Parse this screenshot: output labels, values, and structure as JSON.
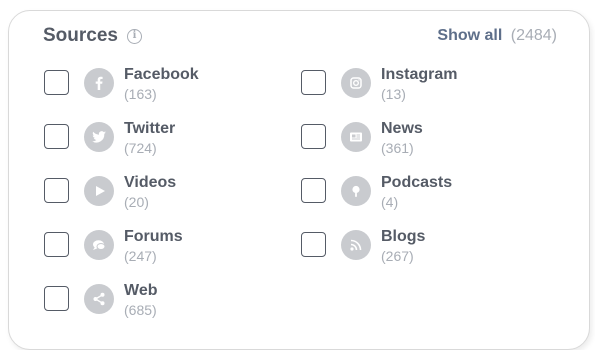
{
  "header": {
    "title": "Sources",
    "info_icon": "info-icon",
    "show_all_label": "Show all",
    "show_all_count": "(2484)"
  },
  "sources": [
    {
      "name": "Facebook",
      "count": "(163)",
      "icon": "facebook-icon",
      "checked": false
    },
    {
      "name": "Instagram",
      "count": "(13)",
      "icon": "instagram-icon",
      "checked": false
    },
    {
      "name": "Twitter",
      "count": "(724)",
      "icon": "twitter-icon",
      "checked": false
    },
    {
      "name": "News",
      "count": "(361)",
      "icon": "news-icon",
      "checked": false
    },
    {
      "name": "Videos",
      "count": "(20)",
      "icon": "play-icon",
      "checked": false
    },
    {
      "name": "Podcasts",
      "count": "(4)",
      "icon": "podcast-icon",
      "checked": false
    },
    {
      "name": "Forums",
      "count": "(247)",
      "icon": "chat-icon",
      "checked": false
    },
    {
      "name": "Blogs",
      "count": "(267)",
      "icon": "rss-icon",
      "checked": false
    },
    {
      "name": "Web",
      "count": "(685)",
      "icon": "share-icon",
      "checked": false
    }
  ],
  "colors": {
    "text": "#555b66",
    "muted": "#a8adb5",
    "link": "#5e6f8a",
    "icon_bg": "#c9cbcf"
  }
}
